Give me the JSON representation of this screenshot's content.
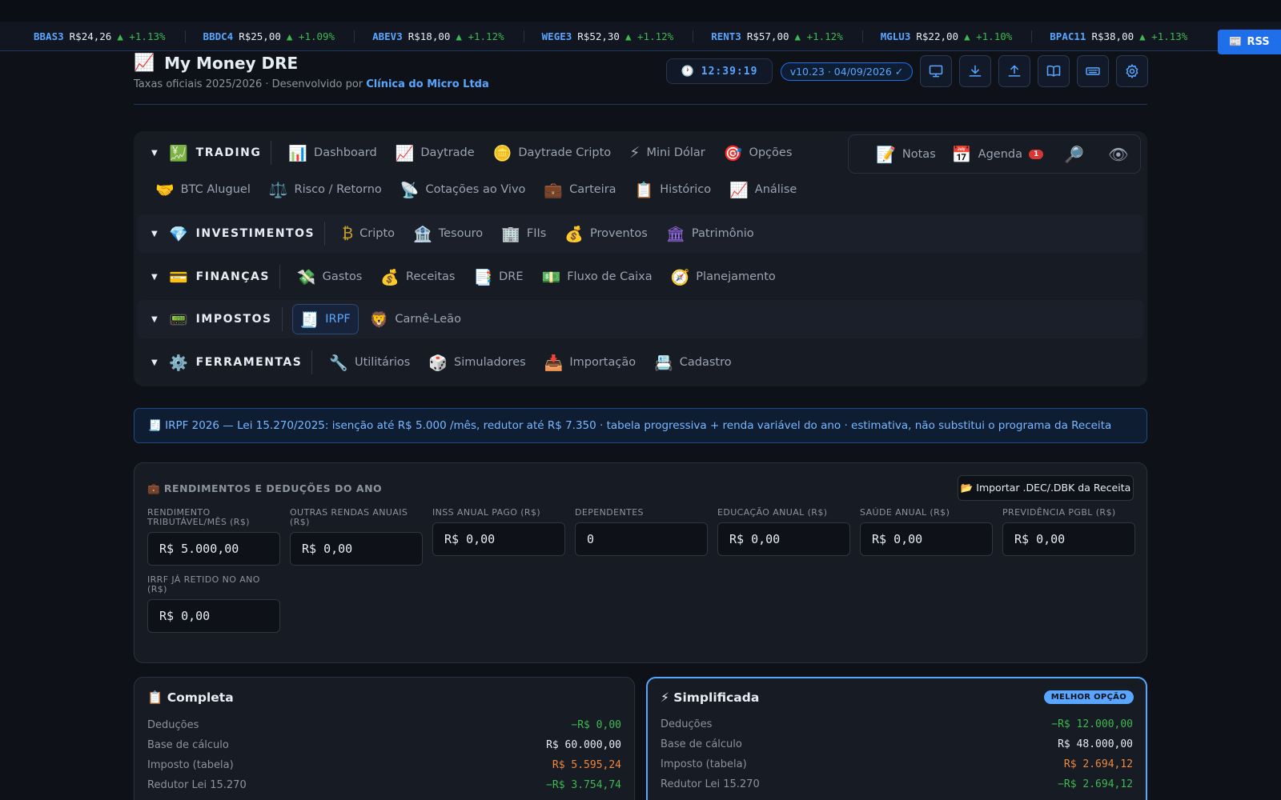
{
  "ticker": [
    {
      "symbol": "BBAS3",
      "price": "R$24,26",
      "change": "▲ +1.13%"
    },
    {
      "symbol": "BBDC4",
      "price": "R$25,00",
      "change": "▲ +1.09%"
    },
    {
      "symbol": "ABEV3",
      "price": "R$18,00",
      "change": "▲ +1.12%"
    },
    {
      "symbol": "WEGE3",
      "price": "R$52,30",
      "change": "▲ +1.12%"
    },
    {
      "symbol": "RENT3",
      "price": "R$57,00",
      "change": "▲ +1.12%"
    },
    {
      "symbol": "MGLU3",
      "price": "R$22,00",
      "change": "▲ +1.10%"
    },
    {
      "symbol": "BPAC11",
      "price": "R$38,00",
      "change": "▲ +1.13%"
    }
  ],
  "rss": {
    "label": "RSS",
    "icon": "📰"
  },
  "header": {
    "logo": "📈",
    "title": "My Money DRE",
    "subtitle_prefix": "Taxas oficiais 2025/2026 · Desenvolvido por ",
    "developer": "Clínica do Micro Ltda",
    "clock_icon": "🕐",
    "clock": "12:39:19",
    "version": "v10.23 · 04/09/2026 ✓",
    "tools": [
      "monitor-icon",
      "download-icon",
      "upload-icon",
      "book-icon",
      "keyboard-icon",
      "gear-icon"
    ]
  },
  "nav": {
    "trading": {
      "label": "TRADING",
      "icon": "💹",
      "items": [
        {
          "icon": "📊",
          "label": "Dashboard"
        },
        {
          "icon": "📈",
          "label": "Daytrade"
        },
        {
          "icon": "🪙",
          "label": "Daytrade Cripto"
        },
        {
          "icon": "⚡",
          "label": "Mini Dólar"
        },
        {
          "icon": "🎯",
          "label": "Opções"
        }
      ],
      "items2": [
        {
          "icon": "🤝",
          "label": "BTC Aluguel"
        },
        {
          "icon": "⚖️",
          "label": "Risco / Retorno"
        },
        {
          "icon": "📡",
          "label": "Cotações ao Vivo"
        },
        {
          "icon": "💼",
          "label": "Carteira"
        },
        {
          "icon": "📋",
          "label": "Histórico"
        },
        {
          "icon": "📈",
          "label": "Análise"
        }
      ]
    },
    "investimentos": {
      "label": "INVESTIMENTOS",
      "icon": "💎",
      "items": [
        {
          "icon": "₿",
          "label": "Cripto"
        },
        {
          "icon": "🏦",
          "label": "Tesouro"
        },
        {
          "icon": "🏢",
          "label": "FIIs"
        },
        {
          "icon": "💰",
          "label": "Proventos"
        },
        {
          "icon": "🏛",
          "label": "Patrimônio"
        }
      ]
    },
    "financas": {
      "label": "FINANÇAS",
      "icon": "💳",
      "items": [
        {
          "icon": "💸",
          "label": "Gastos"
        },
        {
          "icon": "💰",
          "label": "Receitas"
        },
        {
          "icon": "📑",
          "label": "DRE"
        },
        {
          "icon": "💵",
          "label": "Fluxo de Caixa"
        },
        {
          "icon": "🧭",
          "label": "Planejamento"
        }
      ]
    },
    "impostos": {
      "label": "IMPOSTOS",
      "icon": "📟",
      "items": [
        {
          "icon": "🧾",
          "label": "IRPF"
        },
        {
          "icon": "🦁",
          "label": "Carnê-Leão"
        }
      ]
    },
    "ferramentas": {
      "label": "FERRAMENTAS",
      "icon": "⚙️",
      "items": [
        {
          "icon": "🔧",
          "label": "Utilitários"
        },
        {
          "icon": "🎲",
          "label": "Simuladores"
        },
        {
          "icon": "📥",
          "label": "Importação"
        },
        {
          "icon": "📇",
          "label": "Cadastro"
        }
      ]
    },
    "arrow": "▼"
  },
  "quick": {
    "notas": {
      "icon": "📝",
      "label": "Notas"
    },
    "agenda": {
      "icon": "📅",
      "label": "Agenda",
      "badge": "1"
    },
    "search_icon": "🔎",
    "eye_icon": "👁"
  },
  "banner": "🧾 IRPF 2026 — Lei 15.270/2025: isenção até  R$ 5.000  /mês, redutor até  R$ 7.350  · tabela progressiva + renda variável do ano · estimativa, não substitui o programa da Receita",
  "rendimentos": {
    "title": "💼 RENDIMENTOS E DEDUÇÕES DO ANO",
    "import_label": "📂 Importar .DEC/.DBK da Receita",
    "fields": [
      {
        "label": "RENDIMENTO TRIBUTÁVEL/MÊS (R$)",
        "value": "R$ 5.000,00"
      },
      {
        "label": "OUTRAS RENDAS ANUAIS (R$)",
        "value": "R$ 0,00"
      },
      {
        "label": "INSS ANUAL PAGO (R$)",
        "value": "R$ 0,00"
      },
      {
        "label": "DEPENDENTES",
        "value": "0"
      },
      {
        "label": "EDUCAÇÃO ANUAL (R$)",
        "value": "R$ 0,00"
      },
      {
        "label": "SAÚDE ANUAL (R$)",
        "value": "R$ 0,00"
      },
      {
        "label": "PREVIDÊNCIA PGBL (R$)",
        "value": "R$ 0,00"
      },
      {
        "label": "IRRF JÁ RETIDO NO ANO (R$)",
        "value": "R$ 0,00"
      }
    ]
  },
  "completa": {
    "title": "📋 Completa",
    "rows": [
      {
        "label": "Deduções",
        "value": "−R$ 0,00"
      },
      {
        "label": "Base de cálculo",
        "value": "R$ 60.000,00"
      },
      {
        "label": "Imposto (tabela)",
        "value": "R$ 5.595,24"
      },
      {
        "label": "Redutor Lei 15.270",
        "value": "−R$ 3.754,74"
      }
    ]
  },
  "simplificada": {
    "title": "⚡ Simplificada",
    "badge": "MELHOR OPÇÃO",
    "rows": [
      {
        "label": "Deduções",
        "value": "−R$ 12.000,00"
      },
      {
        "label": "Base de cálculo",
        "value": "R$ 48.000,00"
      },
      {
        "label": "Imposto (tabela)",
        "value": "R$ 2.694,12"
      },
      {
        "label": "Redutor Lei 15.270",
        "value": "−R$ 2.694,12"
      }
    ]
  }
}
